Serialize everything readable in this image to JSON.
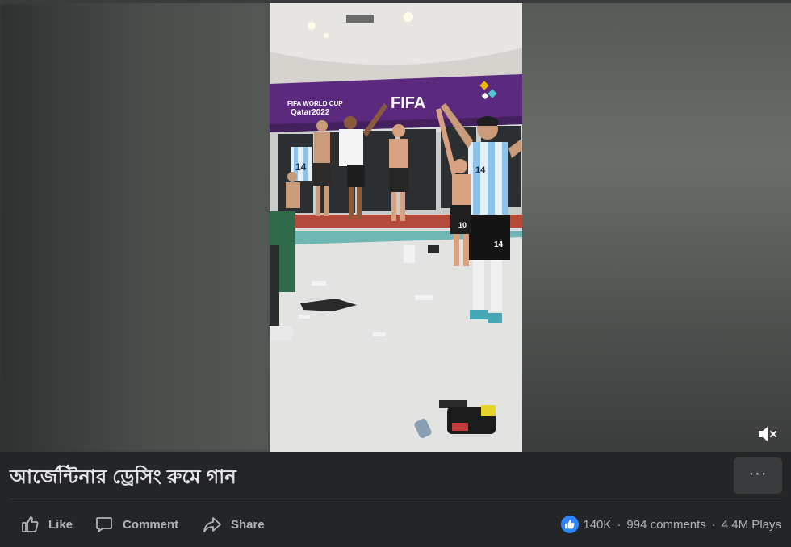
{
  "post": {
    "title": "আর্জেন্টিনার ড্রেসিং রুমে গান"
  },
  "video": {
    "banner_brand": "FIFA",
    "banner_event_line1": "FIFA WORLD CUP",
    "banner_event_line2": "Qatar2022",
    "jersey_number_left": "14",
    "jersey_number_front": "14",
    "shorts_number": "14",
    "jersey_number_mid": "10",
    "mute_icon": "speaker-muted-icon",
    "accent_purple": "#5b2a7e"
  },
  "actions": {
    "like_label": "Like",
    "comment_label": "Comment",
    "share_label": "Share",
    "more_label": "···"
  },
  "stats": {
    "reactions": "140K",
    "separator": "·",
    "comments": "994 comments",
    "plays": "4.4M Plays"
  },
  "colors": {
    "background": "#242526",
    "button": "#3a3b3c",
    "text_primary": "#e4e6eb",
    "text_secondary": "#b0b3b8",
    "like_blue": "#2d88ff"
  }
}
